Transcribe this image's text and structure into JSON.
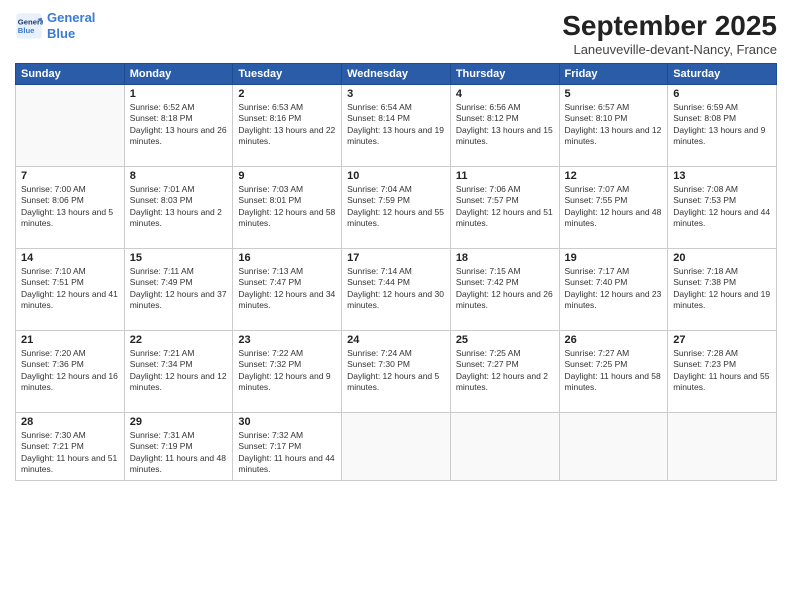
{
  "logo": {
    "line1": "General",
    "line2": "Blue",
    "icon_color": "#3a7bd5"
  },
  "header": {
    "month_title": "September 2025",
    "location": "Laneuveville-devant-Nancy, France"
  },
  "weekdays": [
    "Sunday",
    "Monday",
    "Tuesday",
    "Wednesday",
    "Thursday",
    "Friday",
    "Saturday"
  ],
  "weeks": [
    [
      {
        "day": "",
        "sunrise": "",
        "sunset": "",
        "daylight": ""
      },
      {
        "day": "1",
        "sunrise": "Sunrise: 6:52 AM",
        "sunset": "Sunset: 8:18 PM",
        "daylight": "Daylight: 13 hours and 26 minutes."
      },
      {
        "day": "2",
        "sunrise": "Sunrise: 6:53 AM",
        "sunset": "Sunset: 8:16 PM",
        "daylight": "Daylight: 13 hours and 22 minutes."
      },
      {
        "day": "3",
        "sunrise": "Sunrise: 6:54 AM",
        "sunset": "Sunset: 8:14 PM",
        "daylight": "Daylight: 13 hours and 19 minutes."
      },
      {
        "day": "4",
        "sunrise": "Sunrise: 6:56 AM",
        "sunset": "Sunset: 8:12 PM",
        "daylight": "Daylight: 13 hours and 15 minutes."
      },
      {
        "day": "5",
        "sunrise": "Sunrise: 6:57 AM",
        "sunset": "Sunset: 8:10 PM",
        "daylight": "Daylight: 13 hours and 12 minutes."
      },
      {
        "day": "6",
        "sunrise": "Sunrise: 6:59 AM",
        "sunset": "Sunset: 8:08 PM",
        "daylight": "Daylight: 13 hours and 9 minutes."
      }
    ],
    [
      {
        "day": "7",
        "sunrise": "Sunrise: 7:00 AM",
        "sunset": "Sunset: 8:06 PM",
        "daylight": "Daylight: 13 hours and 5 minutes."
      },
      {
        "day": "8",
        "sunrise": "Sunrise: 7:01 AM",
        "sunset": "Sunset: 8:03 PM",
        "daylight": "Daylight: 13 hours and 2 minutes."
      },
      {
        "day": "9",
        "sunrise": "Sunrise: 7:03 AM",
        "sunset": "Sunset: 8:01 PM",
        "daylight": "Daylight: 12 hours and 58 minutes."
      },
      {
        "day": "10",
        "sunrise": "Sunrise: 7:04 AM",
        "sunset": "Sunset: 7:59 PM",
        "daylight": "Daylight: 12 hours and 55 minutes."
      },
      {
        "day": "11",
        "sunrise": "Sunrise: 7:06 AM",
        "sunset": "Sunset: 7:57 PM",
        "daylight": "Daylight: 12 hours and 51 minutes."
      },
      {
        "day": "12",
        "sunrise": "Sunrise: 7:07 AM",
        "sunset": "Sunset: 7:55 PM",
        "daylight": "Daylight: 12 hours and 48 minutes."
      },
      {
        "day": "13",
        "sunrise": "Sunrise: 7:08 AM",
        "sunset": "Sunset: 7:53 PM",
        "daylight": "Daylight: 12 hours and 44 minutes."
      }
    ],
    [
      {
        "day": "14",
        "sunrise": "Sunrise: 7:10 AM",
        "sunset": "Sunset: 7:51 PM",
        "daylight": "Daylight: 12 hours and 41 minutes."
      },
      {
        "day": "15",
        "sunrise": "Sunrise: 7:11 AM",
        "sunset": "Sunset: 7:49 PM",
        "daylight": "Daylight: 12 hours and 37 minutes."
      },
      {
        "day": "16",
        "sunrise": "Sunrise: 7:13 AM",
        "sunset": "Sunset: 7:47 PM",
        "daylight": "Daylight: 12 hours and 34 minutes."
      },
      {
        "day": "17",
        "sunrise": "Sunrise: 7:14 AM",
        "sunset": "Sunset: 7:44 PM",
        "daylight": "Daylight: 12 hours and 30 minutes."
      },
      {
        "day": "18",
        "sunrise": "Sunrise: 7:15 AM",
        "sunset": "Sunset: 7:42 PM",
        "daylight": "Daylight: 12 hours and 26 minutes."
      },
      {
        "day": "19",
        "sunrise": "Sunrise: 7:17 AM",
        "sunset": "Sunset: 7:40 PM",
        "daylight": "Daylight: 12 hours and 23 minutes."
      },
      {
        "day": "20",
        "sunrise": "Sunrise: 7:18 AM",
        "sunset": "Sunset: 7:38 PM",
        "daylight": "Daylight: 12 hours and 19 minutes."
      }
    ],
    [
      {
        "day": "21",
        "sunrise": "Sunrise: 7:20 AM",
        "sunset": "Sunset: 7:36 PM",
        "daylight": "Daylight: 12 hours and 16 minutes."
      },
      {
        "day": "22",
        "sunrise": "Sunrise: 7:21 AM",
        "sunset": "Sunset: 7:34 PM",
        "daylight": "Daylight: 12 hours and 12 minutes."
      },
      {
        "day": "23",
        "sunrise": "Sunrise: 7:22 AM",
        "sunset": "Sunset: 7:32 PM",
        "daylight": "Daylight: 12 hours and 9 minutes."
      },
      {
        "day": "24",
        "sunrise": "Sunrise: 7:24 AM",
        "sunset": "Sunset: 7:30 PM",
        "daylight": "Daylight: 12 hours and 5 minutes."
      },
      {
        "day": "25",
        "sunrise": "Sunrise: 7:25 AM",
        "sunset": "Sunset: 7:27 PM",
        "daylight": "Daylight: 12 hours and 2 minutes."
      },
      {
        "day": "26",
        "sunrise": "Sunrise: 7:27 AM",
        "sunset": "Sunset: 7:25 PM",
        "daylight": "Daylight: 11 hours and 58 minutes."
      },
      {
        "day": "27",
        "sunrise": "Sunrise: 7:28 AM",
        "sunset": "Sunset: 7:23 PM",
        "daylight": "Daylight: 11 hours and 55 minutes."
      }
    ],
    [
      {
        "day": "28",
        "sunrise": "Sunrise: 7:30 AM",
        "sunset": "Sunset: 7:21 PM",
        "daylight": "Daylight: 11 hours and 51 minutes."
      },
      {
        "day": "29",
        "sunrise": "Sunrise: 7:31 AM",
        "sunset": "Sunset: 7:19 PM",
        "daylight": "Daylight: 11 hours and 48 minutes."
      },
      {
        "day": "30",
        "sunrise": "Sunrise: 7:32 AM",
        "sunset": "Sunset: 7:17 PM",
        "daylight": "Daylight: 11 hours and 44 minutes."
      },
      {
        "day": "",
        "sunrise": "",
        "sunset": "",
        "daylight": ""
      },
      {
        "day": "",
        "sunrise": "",
        "sunset": "",
        "daylight": ""
      },
      {
        "day": "",
        "sunrise": "",
        "sunset": "",
        "daylight": ""
      },
      {
        "day": "",
        "sunrise": "",
        "sunset": "",
        "daylight": ""
      }
    ]
  ]
}
